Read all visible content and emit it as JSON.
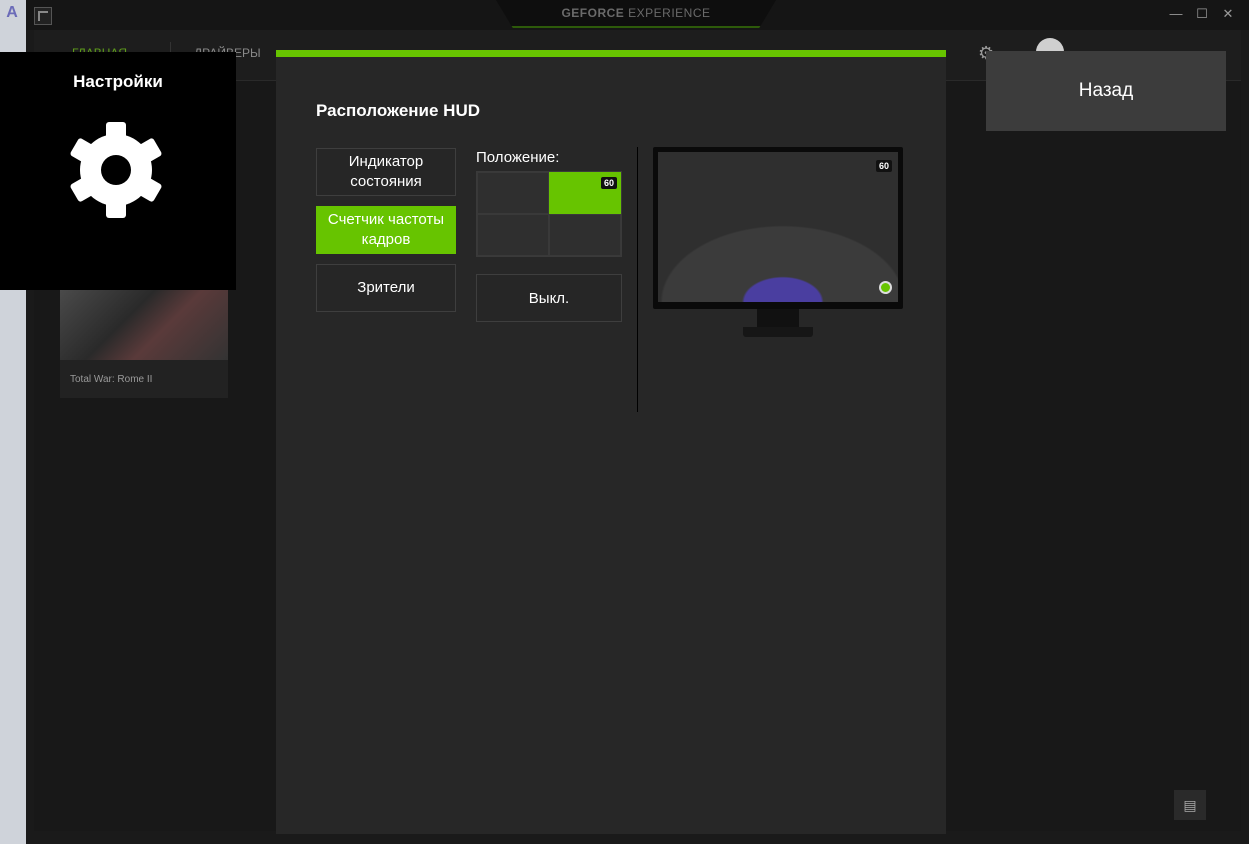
{
  "desktop": {
    "icon_letter": "A"
  },
  "titlebar": {
    "brand_bold": "GEFORCE",
    "brand_light": "EXPERIENCE",
    "minimize": "—",
    "maximize": "☐",
    "close": "✕"
  },
  "nav": {
    "home": "ГЛАВНАЯ",
    "drivers": "ДРАЙВЕРЫ"
  },
  "library": {
    "game_title": "Total War: Rome II"
  },
  "settings": {
    "title": "Настройки"
  },
  "hud_panel": {
    "title": "Расположение HUD",
    "options": [
      {
        "label": "Индикатор состояния",
        "active": false
      },
      {
        "label": "Счетчик частоты кадров",
        "active": true
      },
      {
        "label": "Зрители",
        "active": false
      }
    ],
    "position_label": "Положение:",
    "position_grid": [
      {
        "slot": "top-left",
        "active": false
      },
      {
        "slot": "top-right",
        "active": true
      },
      {
        "slot": "bottom-left",
        "active": false
      },
      {
        "slot": "bottom-right",
        "active": false
      }
    ],
    "fps_value": "60",
    "off_label": "Выкл."
  },
  "back_button": "Назад",
  "colors": {
    "accent": "#67c400",
    "panel": "#272727",
    "sidebar": "#000000"
  }
}
